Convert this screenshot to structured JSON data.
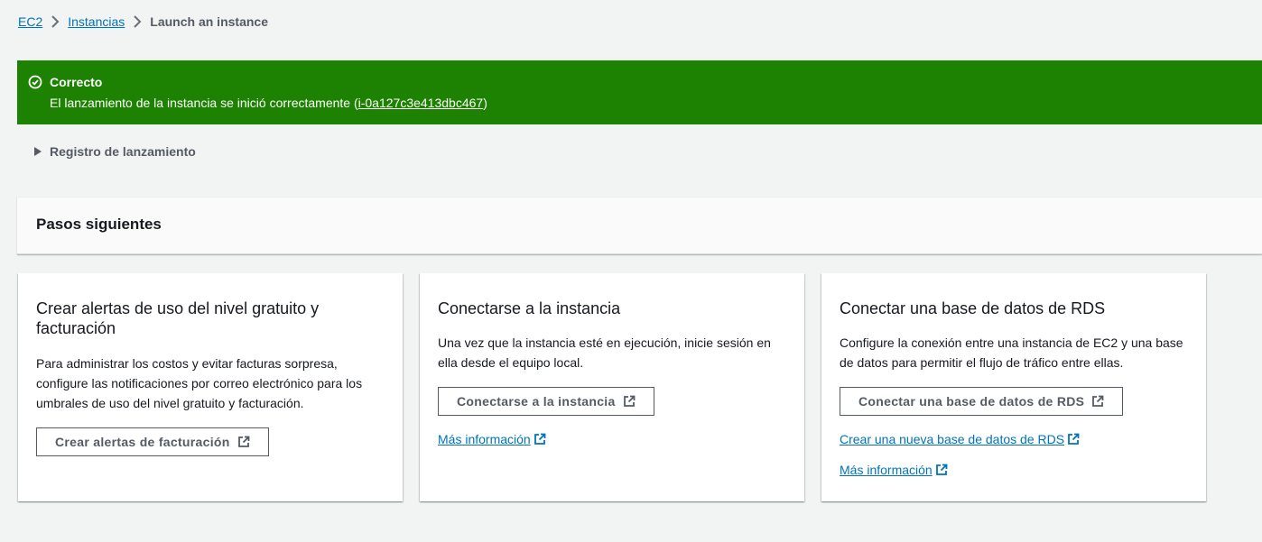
{
  "breadcrumb": {
    "items": [
      "EC2",
      "Instancias"
    ],
    "current": "Launch an instance"
  },
  "flash": {
    "title": "Correcto",
    "message_prefix": "El lanzamiento de la instancia se inició correctamente (",
    "instance_id": "i-0a127c3e413dbc467",
    "message_suffix": ")",
    "color": "#1d8102"
  },
  "launch_log": {
    "label": "Registro de lanzamiento"
  },
  "next_steps": {
    "title": "Pasos siguientes",
    "cards": [
      {
        "title": "Crear alertas de uso del nivel gratuito y facturación",
        "description": "Para administrar los costos y evitar facturas sorpresa, configure las notificaciones por correo electrónico para los umbrales de uso del nivel gratuito y facturación.",
        "button": "Crear alertas de facturación"
      },
      {
        "title": "Conectarse a la instancia",
        "description": "Una vez que la instancia esté en ejecución, inicie sesión en ella desde el equipo local.",
        "button": "Conectarse a la instancia",
        "link": "Más información"
      },
      {
        "title": "Conectar una base de datos de RDS",
        "description": "Configure la conexión entre una instancia de EC2 y una base de datos para permitir el flujo de tráfico entre ellas.",
        "button": "Conectar una base de datos de RDS",
        "link1": "Crear una nueva base de datos de RDS",
        "link2": "Más información"
      }
    ]
  },
  "colors": {
    "link": "#0073bb",
    "success": "#1d8102",
    "background": "#f2f3f3"
  },
  "icons": [
    "chevron-right-icon",
    "check-circle-icon",
    "caret-right-icon",
    "external-link-icon"
  ]
}
